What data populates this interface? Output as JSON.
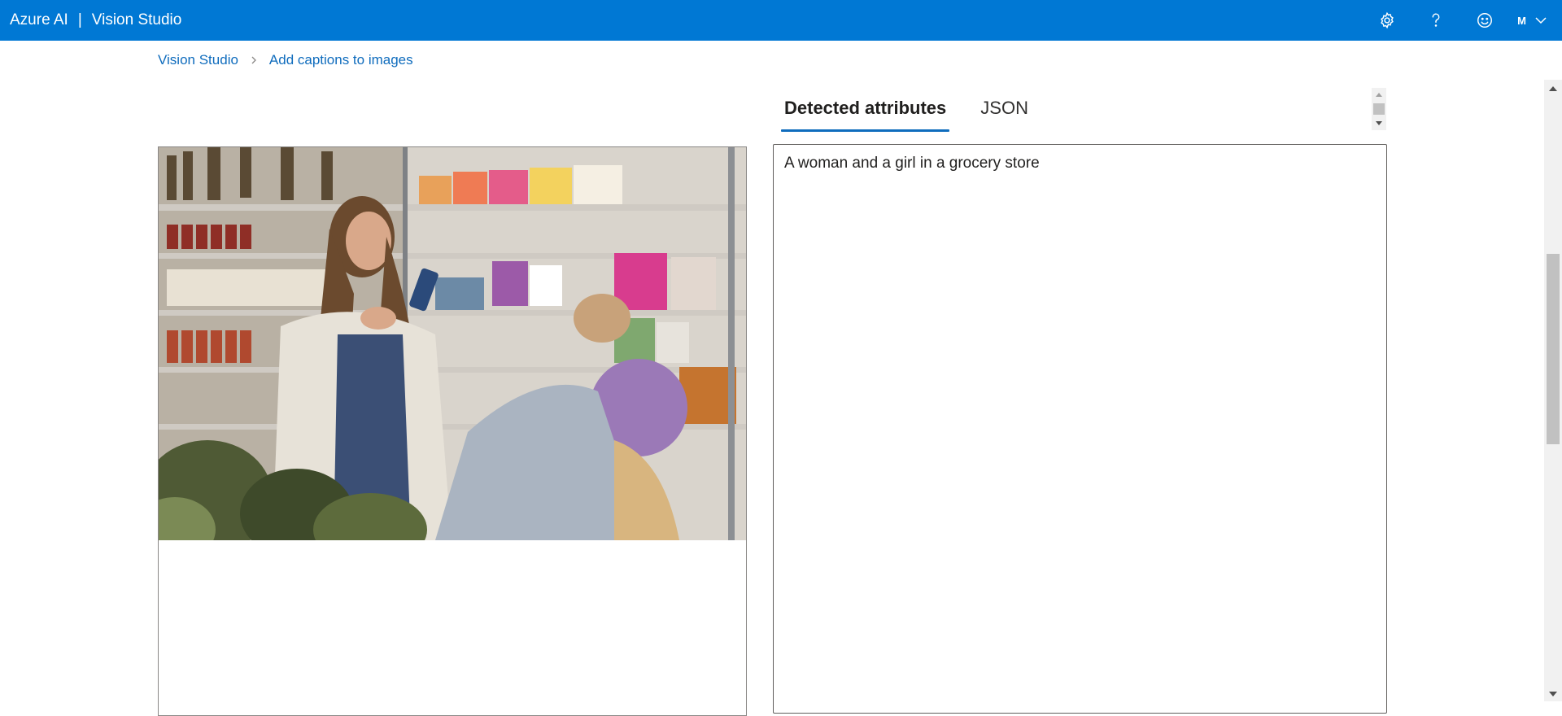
{
  "header": {
    "brand": "Azure AI",
    "separator": "|",
    "product": "Vision Studio",
    "user_initial": "M",
    "icons": [
      "gear-icon",
      "help-icon",
      "feedback-smiley-icon",
      "chevron-down-icon"
    ],
    "bar_color": "#0078d4"
  },
  "breadcrumb": {
    "items": [
      {
        "label": "Vision Studio"
      },
      {
        "label": "Add captions to images"
      }
    ],
    "separator_icon": "chevron-right-icon"
  },
  "image_panel": {
    "image": "photo-woman-and-girl-in-grocery-store"
  },
  "tabs": [
    {
      "label": "Detected attributes",
      "active": true
    },
    {
      "label": "JSON",
      "active": false
    }
  ],
  "result": {
    "caption": "A woman and a girl in a grocery store"
  },
  "colors": {
    "accent": "#0f6cbd",
    "header": "#0078d4",
    "text": "#323130"
  }
}
